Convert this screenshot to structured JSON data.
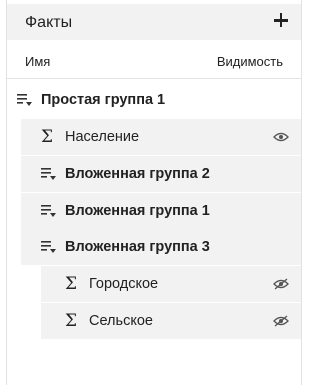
{
  "panel": {
    "title": "Факты",
    "add_icon": "plus-icon",
    "columns": {
      "name": "Имя",
      "visibility": "Видимость"
    }
  },
  "tree": {
    "group_root": {
      "label": "Простая группа 1",
      "icon": "group-collapse-icon"
    },
    "items": [
      {
        "label": "Население",
        "icon": "sigma-icon",
        "visibility": "visible"
      },
      {
        "label": "Вложенная группа 2",
        "icon": "group-collapse-icon"
      },
      {
        "label": "Вложенная группа 1",
        "icon": "group-collapse-icon"
      },
      {
        "label": "Вложенная группа 3",
        "icon": "group-collapse-icon"
      }
    ],
    "nested_items": [
      {
        "label": "Городское",
        "icon": "sigma-icon",
        "visibility": "hidden"
      },
      {
        "label": "Сельское",
        "icon": "sigma-icon",
        "visibility": "hidden"
      }
    ]
  }
}
